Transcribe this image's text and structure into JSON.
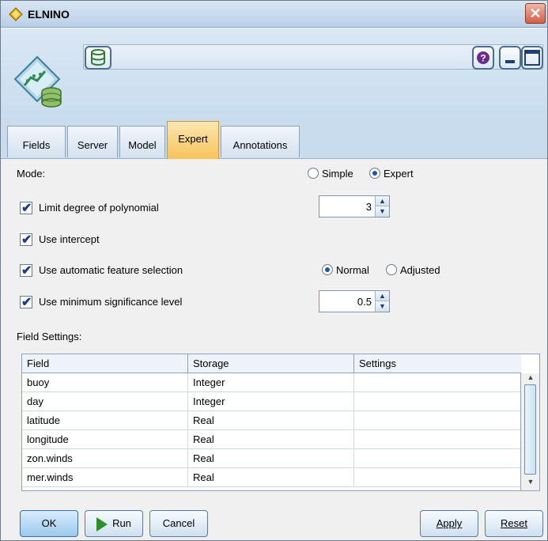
{
  "window": {
    "title": "ELNINO",
    "close_glyph": "✕"
  },
  "header": {
    "node_icon": "regression-node-icon",
    "db_icon": "database-icon",
    "help_icon": "help-icon",
    "minimize_icon": "minimize-icon",
    "maximize_icon": "maximize-icon"
  },
  "tabs": [
    {
      "label": "Fields"
    },
    {
      "label": "Server"
    },
    {
      "label": "Model"
    },
    {
      "label": "Expert"
    },
    {
      "label": "Annotations"
    }
  ],
  "active_tab": "Expert",
  "expert": {
    "mode_label": "Mode:",
    "mode_simple": "Simple",
    "mode_expert": "Expert",
    "mode_selected": "Expert",
    "limit_degree_label": "Limit degree of polynomial",
    "limit_degree_checked": true,
    "limit_degree_value": "3",
    "use_intercept_label": "Use intercept",
    "use_intercept_checked": true,
    "auto_feature_label": "Use automatic feature selection",
    "auto_feature_checked": true,
    "auto_normal": "Normal",
    "auto_adjusted": "Adjusted",
    "auto_selected": "Normal",
    "min_sig_label": "Use minimum significance level",
    "min_sig_checked": true,
    "min_sig_value": "0.5",
    "field_settings_label": "Field Settings:"
  },
  "table": {
    "columns": [
      "Field",
      "Storage",
      "Settings"
    ],
    "rows": [
      {
        "field": "buoy",
        "storage": "Integer",
        "settings": ""
      },
      {
        "field": "day",
        "storage": "Integer",
        "settings": ""
      },
      {
        "field": "latitude",
        "storage": "Real",
        "settings": ""
      },
      {
        "field": "longitude",
        "storage": "Real",
        "settings": ""
      },
      {
        "field": "zon.winds",
        "storage": "Real",
        "settings": ""
      },
      {
        "field": "mer.winds",
        "storage": "Real",
        "settings": ""
      }
    ]
  },
  "buttons": {
    "ok": "OK",
    "run": "Run",
    "cancel": "Cancel",
    "apply": "Apply",
    "reset": "Reset"
  },
  "colors": {
    "active_tab": "#f7c35a",
    "header_bg": "#c8dcee",
    "check_color": "#1a3d8f"
  }
}
